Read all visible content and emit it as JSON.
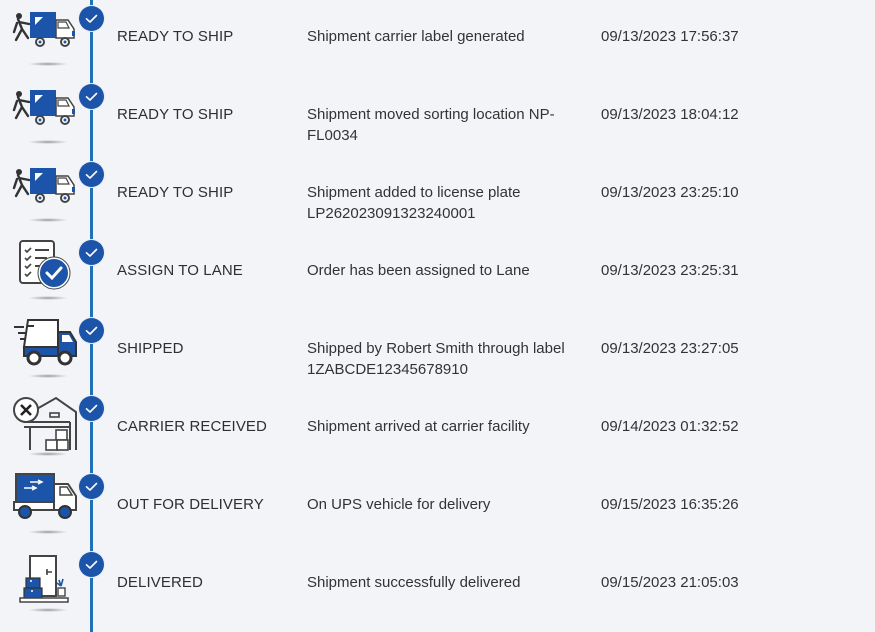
{
  "colors": {
    "accent": "#1b54a8",
    "timeline_line": "#1f72b8",
    "background": "#f2f4f7",
    "text": "#333333"
  },
  "events": [
    {
      "status": "READY TO SHIP",
      "description": "Shipment carrier label generated",
      "timestamp": "09/13/2023 17:56:37",
      "icon": "loading-truck-icon",
      "completed": true
    },
    {
      "status": "READY TO SHIP",
      "description": "Shipment moved sorting location NP-FL0034",
      "timestamp": "09/13/2023 18:04:12",
      "icon": "loading-truck-icon",
      "completed": true
    },
    {
      "status": "READY TO SHIP",
      "description": "Shipment added to license plate LP262023091323240001",
      "timestamp": "09/13/2023 23:25:10",
      "icon": "loading-truck-icon",
      "completed": true
    },
    {
      "status": "ASSIGN TO LANE",
      "description": "Order has been assigned to Lane",
      "timestamp": "09/13/2023 23:25:31",
      "icon": "checklist-icon",
      "completed": true
    },
    {
      "status": "SHIPPED",
      "description": "Shipped by Robert Smith through label 1ZABCDE12345678910",
      "timestamp": "09/13/2023 23:27:05",
      "icon": "fast-truck-icon",
      "completed": true
    },
    {
      "status": "CARRIER RECEIVED",
      "description": "Shipment arrived at carrier facility",
      "timestamp": "09/14/2023 01:32:52",
      "icon": "warehouse-icon",
      "completed": true
    },
    {
      "status": "OUT FOR DELIVERY",
      "description": "On UPS vehicle for delivery",
      "timestamp": "09/15/2023 16:35:26",
      "icon": "delivery-truck-icon",
      "completed": true
    },
    {
      "status": "DELIVERED",
      "description": "Shipment successfully delivered",
      "timestamp": "09/15/2023 21:05:03",
      "icon": "doorstep-package-icon",
      "completed": true
    }
  ]
}
